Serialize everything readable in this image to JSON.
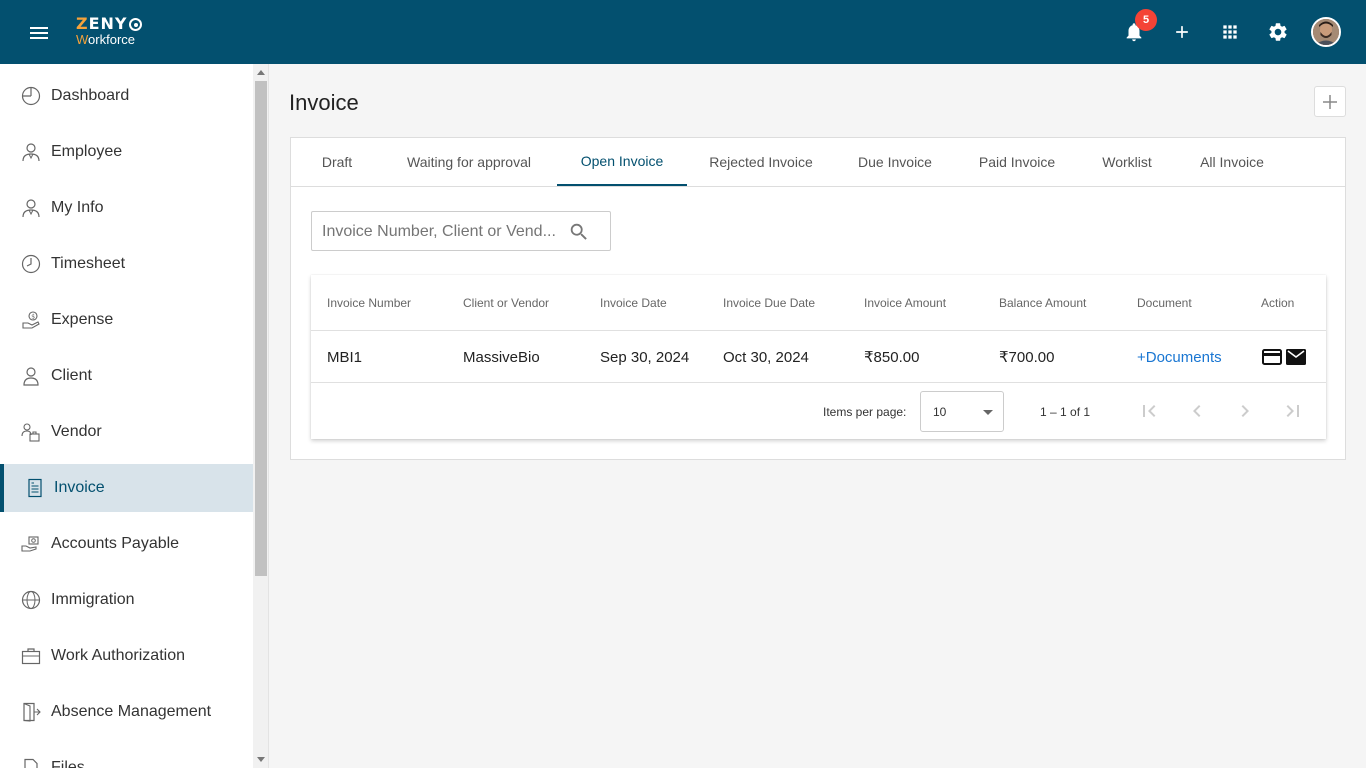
{
  "app": {
    "logo_top": "ZENY",
    "logo_bottom": "Workforce",
    "notification_count": "5"
  },
  "sidebar": {
    "items": [
      {
        "label": "Dashboard",
        "icon": "dashboard-icon"
      },
      {
        "label": "Employee",
        "icon": "employee-icon"
      },
      {
        "label": "My Info",
        "icon": "my-info-icon"
      },
      {
        "label": "Timesheet",
        "icon": "clock-icon"
      },
      {
        "label": "Expense",
        "icon": "expense-icon"
      },
      {
        "label": "Client",
        "icon": "person-icon"
      },
      {
        "label": "Vendor",
        "icon": "vendor-icon"
      },
      {
        "label": "Invoice",
        "icon": "invoice-icon",
        "active": true
      },
      {
        "label": "Accounts Payable",
        "icon": "hand-money-icon"
      },
      {
        "label": "Immigration",
        "icon": "globe-icon"
      },
      {
        "label": "Work Authorization",
        "icon": "briefcase-icon"
      },
      {
        "label": "Absence Management",
        "icon": "exit-door-icon"
      },
      {
        "label": "Files",
        "icon": "file-icon"
      }
    ]
  },
  "page": {
    "title": "Invoice"
  },
  "tabs": [
    {
      "label": "Draft"
    },
    {
      "label": "Waiting for approval"
    },
    {
      "label": "Open Invoice",
      "active": true
    },
    {
      "label": "Rejected Invoice"
    },
    {
      "label": "Due Invoice"
    },
    {
      "label": "Paid Invoice"
    },
    {
      "label": "Worklist"
    },
    {
      "label": "All Invoice"
    }
  ],
  "search": {
    "placeholder": "Invoice Number, Client or Vend..."
  },
  "table": {
    "headers": [
      "Invoice Number",
      "Client or Vendor",
      "Invoice Date",
      "Invoice Due Date",
      "Invoice Amount",
      "Balance Amount",
      "Document",
      "Action"
    ],
    "rows": [
      {
        "invoice_number": "MBI1",
        "client": "MassiveBio",
        "invoice_date": "Sep 30, 2024",
        "due_date": "Oct 30, 2024",
        "amount": "₹850.00",
        "balance": "₹700.00",
        "document": "+Documents"
      }
    ]
  },
  "paginator": {
    "items_per_page_label": "Items per page:",
    "items_per_page": "10",
    "range": "1 – 1 of 1"
  },
  "colors": {
    "brand": "#03506f",
    "accent": "#f4a23b",
    "badge": "#f44336",
    "link": "#1976d2"
  }
}
